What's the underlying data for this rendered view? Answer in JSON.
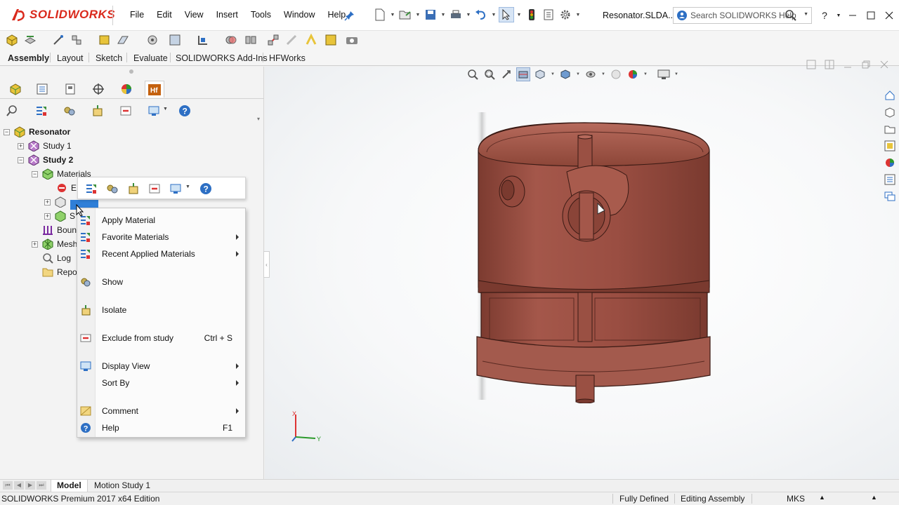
{
  "app": {
    "logo_text": "SOLIDWORKS",
    "document_title": "Resonator.SLDA...",
    "help_search_placeholder": "Search SOLIDWORKS Help",
    "help_button": "?",
    "colors": {
      "brand_red": "#da291c",
      "copper": "#9e4a3c",
      "selection_blue": "#2f7fd8"
    }
  },
  "menubar": [
    "File",
    "Edit",
    "View",
    "Insert",
    "Tools",
    "Window",
    "Help"
  ],
  "command_tabs": [
    {
      "label": "Assembly",
      "active": true
    },
    {
      "label": "Layout",
      "active": false
    },
    {
      "label": "Sketch",
      "active": false
    },
    {
      "label": "Evaluate",
      "active": false
    },
    {
      "label": "SOLIDWORKS Add-Ins",
      "active": false
    },
    {
      "label": "HFWorks",
      "active": false
    }
  ],
  "feature_manager_tabs": [
    "feature-tree",
    "property-manager",
    "configuration-manager",
    "dimxpert",
    "display-manager",
    "hfworks"
  ],
  "tree": {
    "root": "Resonator",
    "study1": "Study 1",
    "study2": "Study 2",
    "materials": "Materials",
    "partial_e": "E",
    "partial_s": "S",
    "boundary": "Boun",
    "mesh": "Mesh",
    "log": "Log",
    "report": "Repo"
  },
  "context_menu": {
    "apply_material": "Apply Material",
    "favorite_materials": "Favorite Materials",
    "recent_applied_materials": "Recent Applied Materials",
    "show": "Show",
    "isolate": "Isolate",
    "exclude_from_study": "Exclude from study",
    "exclude_shortcut": "Ctrl + S",
    "display_view": "Display View",
    "sort_by": "Sort By",
    "comment": "Comment",
    "help": "Help",
    "help_shortcut": "F1"
  },
  "triad": {
    "x_label": "X",
    "y_label": "Y"
  },
  "bottom_tabs": [
    {
      "label": "Model",
      "active": true
    },
    {
      "label": "Motion Study 1",
      "active": false
    }
  ],
  "status": {
    "edition": "SOLIDWORKS Premium 2017 x64 Edition",
    "definition": "Fully Defined",
    "mode": "Editing Assembly",
    "units": "MKS"
  }
}
